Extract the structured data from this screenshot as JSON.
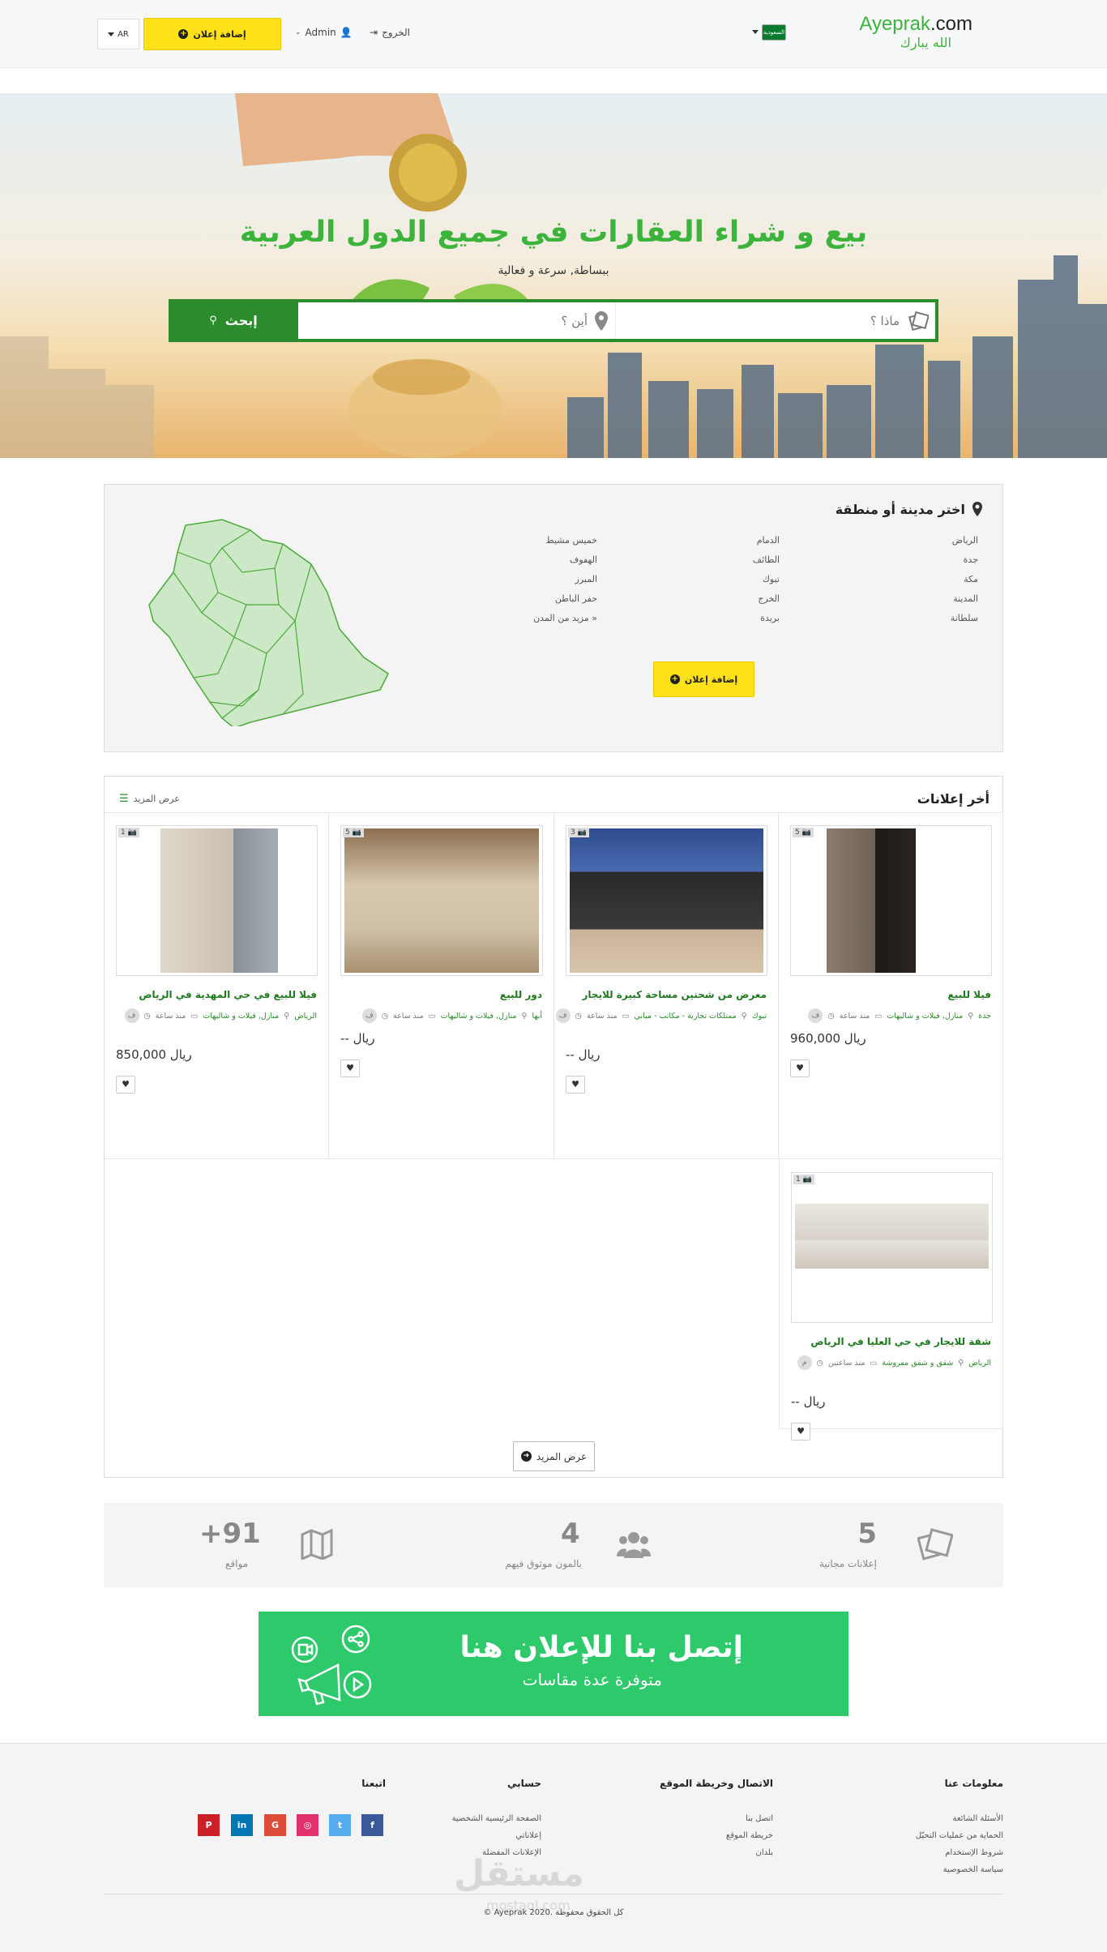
{
  "header": {
    "logo_main": "Ayeprak",
    "logo_tld": ".com",
    "logo_sub": "الله يبارك",
    "flag_label": "السعودية",
    "logout": "الخروج",
    "user": "Admin",
    "add_ad": "إضافة إعلان",
    "lang": "AR"
  },
  "hero": {
    "title": "بيع و شراء العقارات في جميع الدول العربية",
    "subtitle": "ببساطة, سرعة و فعالية",
    "search_what_placeholder": "ماذا ؟",
    "search_where_placeholder": "أين ؟",
    "search_button": "إبحث"
  },
  "regions": {
    "title": "اختر مدينة أو منطقة",
    "col1": [
      "الرياض",
      "جدة",
      "مكة",
      "المدينة",
      "سلطانة"
    ],
    "col2": [
      "الدمام",
      "الطائف",
      "تبوك",
      "الخرج",
      "بريدة"
    ],
    "col3": [
      "خميس مشيط",
      "الهفوف",
      "المبرز",
      "حفر الباطن",
      "مزيد من المدن »"
    ],
    "add_ad": "إضافة إعلان"
  },
  "listings": {
    "title": "أخر إعلانات",
    "more_link": "عرض المزيد",
    "more_button": "عرض المزيد",
    "items": [
      {
        "count": "5",
        "title": "فيلا للبيع",
        "avatar": "ف",
        "time": "منذ ساعة",
        "category": "منازل, فيلات و شاليهات",
        "city": "جدة",
        "price": "960,000 ريال"
      },
      {
        "count": "3",
        "title": "معرض من شحنين مساحة كبيرة للايجار",
        "avatar": "ف",
        "time": "منذ ساعة",
        "category": "ممتلكات تجارية - مكاتب - مباني",
        "city": "تبوك",
        "price": "-- ريال"
      },
      {
        "count": "5",
        "title": "دور للبيع",
        "avatar": "ف",
        "time": "منذ ساعة",
        "category": "منازل, فيلات و شاليهات",
        "city": "أبها",
        "price": "-- ريال"
      },
      {
        "count": "1",
        "title": "فيلا للبيع في حي المهدية في الرياض",
        "avatar": "ف",
        "time": "منذ ساعة",
        "category": "منازل, فيلات و شاليهات",
        "city": "الرياض",
        "price": "850,000 ريال"
      },
      {
        "count": "1",
        "title": "شقة للايجار في حي العليا في الرياض",
        "avatar": "م",
        "time": "منذ ساعتين",
        "category": "شقق و شقق مفروشة",
        "city": "الرياض",
        "price": "-- ريال"
      }
    ]
  },
  "stats": [
    {
      "number": "5",
      "label": "إعلانات مجانية",
      "icon": "ads-icon"
    },
    {
      "number": "4",
      "label": "بالمون موثوق فيهم",
      "icon": "users-icon"
    },
    {
      "number": "+91",
      "label": "مواقع",
      "icon": "map-icon"
    }
  ],
  "banner": {
    "line1": "إتصل بنا للإعلان هنا",
    "line2": "متوفرة عدة مقاسات"
  },
  "footer": {
    "col1": {
      "title": "معلومات عنا",
      "links": [
        "الأسئلة الشائعة",
        "الحماية من عمليات التحيّل",
        "شروط الإستخدام",
        "سياسة الخصوصية"
      ]
    },
    "col2": {
      "title": "الاتصال وخريطة الموقع",
      "links": [
        "اتصل بنا",
        "خريطة الموقع",
        "بلدان"
      ]
    },
    "col3": {
      "title": "حسابي",
      "links": [
        "الصفحة الرئيسية الشخصية",
        "إعلاناتي",
        "الإعلانات المفضلة"
      ]
    },
    "col4": {
      "title": "اتبعنا"
    },
    "copyright": "© Ayeprak 2020. كل الحقوق محفوظة",
    "watermark": "مستقل",
    "watermark_sub": "mostaql.com"
  },
  "colors": {
    "brand_green": "#3cb43c",
    "search_green": "#2a8c2a",
    "button_yellow": "#ffe11a",
    "banner_green": "#2ec96b"
  }
}
